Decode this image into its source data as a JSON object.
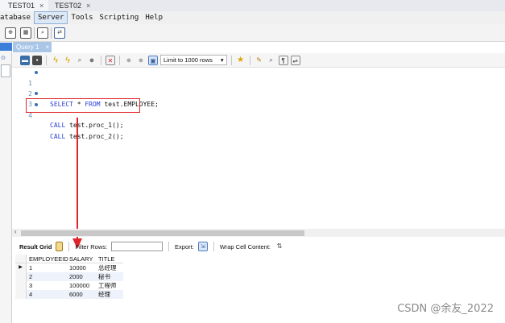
{
  "tabs": [
    {
      "label": "TEST01",
      "close": "×"
    },
    {
      "label": "TEST02",
      "close": "×"
    }
  ],
  "menu": [
    "atabase",
    "Server",
    "Tools",
    "Scripting",
    "Help"
  ],
  "query_tab": {
    "label": "Query 1",
    "close": "×"
  },
  "limit": {
    "label": "Limit to 1000 rows"
  },
  "editor": {
    "lines": [
      {
        "num": "1",
        "kw": "SELECT",
        "rest": " * ",
        "kw2": "FROM",
        "rest2": " test.EMPLOYEE;"
      },
      {
        "num": "2"
      },
      {
        "num": "3",
        "kw": "CALL",
        "rest": " test.proc_1();"
      },
      {
        "num": "4",
        "kw": "CALL",
        "rest": " test.proc_2();"
      }
    ]
  },
  "result_toolbar": {
    "result_grid": "Result Grid",
    "filter_rows": "Filter Rows:",
    "export": "Export:",
    "wrap": "Wrap Cell Content:"
  },
  "grid": {
    "columns": [
      "EMPLOYEEID",
      "SALARY",
      "TITLE"
    ],
    "rows": [
      [
        "1",
        "10000",
        "总经理"
      ],
      [
        "2",
        "2000",
        "秘书"
      ],
      [
        "3",
        "100000",
        "工程师"
      ],
      [
        "4",
        "6000",
        "经理"
      ]
    ]
  },
  "watermark": "CSDN @余友_2022",
  "colors": {
    "highlight": "#e0252a",
    "keyword": "#2a3fd4",
    "accent": "#a9c6e8"
  }
}
